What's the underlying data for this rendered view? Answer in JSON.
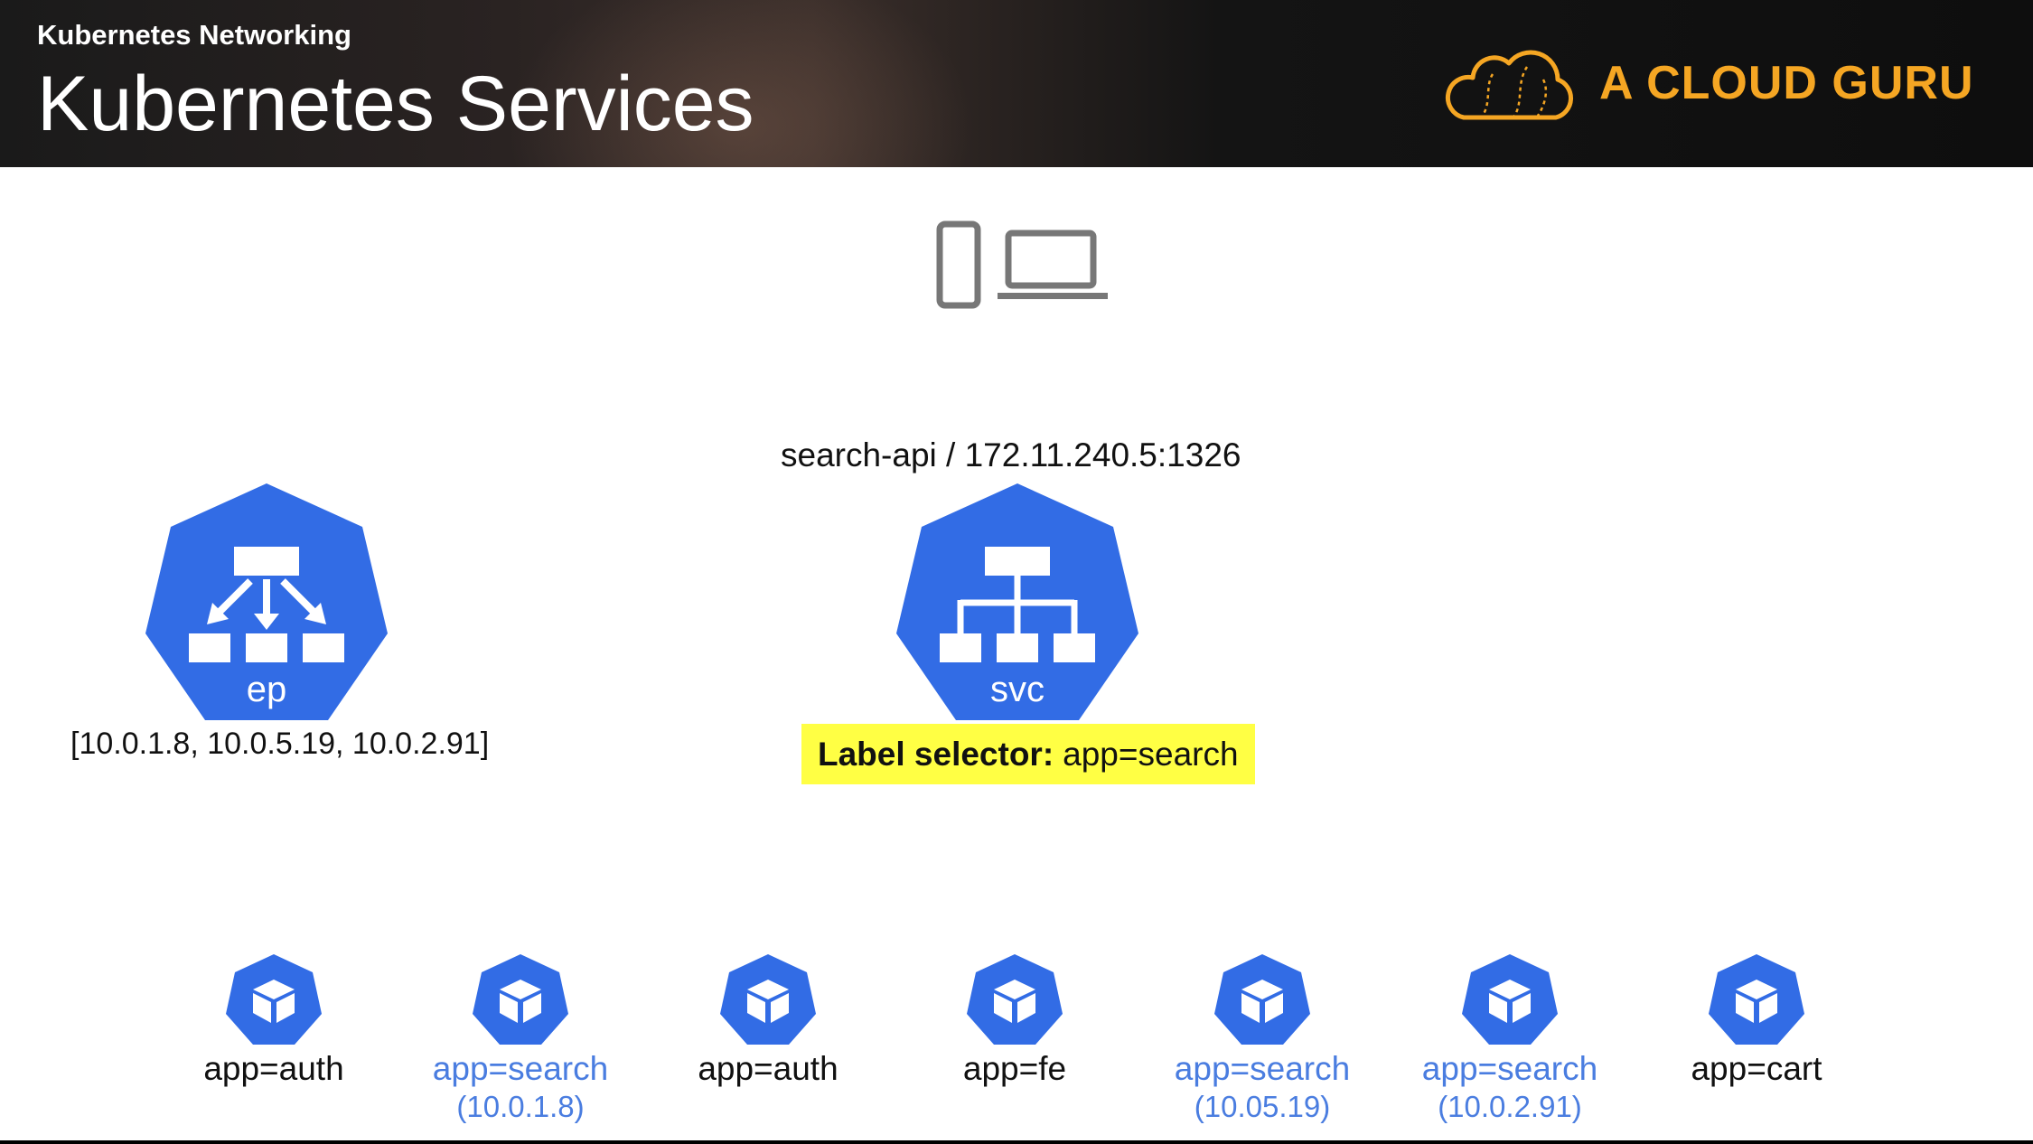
{
  "header": {
    "kicker": "Kubernetes Networking",
    "title": "Kubernetes Services",
    "logo_text": "A CLOUD GURU",
    "logo_color": "#f5a623"
  },
  "diagram": {
    "client_icons": [
      "phone-icon",
      "laptop-icon"
    ],
    "service": {
      "name_ip": "search-api / 172.11.240.5:1326",
      "icon_label": "svc",
      "selector_key": "Label selector:",
      "selector_value": "app=search"
    },
    "endpoints": {
      "icon_label": "ep",
      "ips": "[10.0.1.8, 10.0.5.19, 10.0.2.91]"
    },
    "pods": [
      {
        "label": "app=auth",
        "ip": "",
        "selected": false
      },
      {
        "label": "app=search",
        "ip": "(10.0.1.8)",
        "selected": true
      },
      {
        "label": "app=auth",
        "ip": "",
        "selected": false
      },
      {
        "label": "app=fe",
        "ip": "",
        "selected": false
      },
      {
        "label": "app=search",
        "ip": "(10.05.19)",
        "selected": true
      },
      {
        "label": "app=search",
        "ip": "(10.0.2.91)",
        "selected": true
      },
      {
        "label": "app=cart",
        "ip": "",
        "selected": false
      }
    ],
    "colors": {
      "k8s_blue": "#326ce5",
      "selected_text": "#4a7de0",
      "highlight": "#ffff44"
    }
  }
}
